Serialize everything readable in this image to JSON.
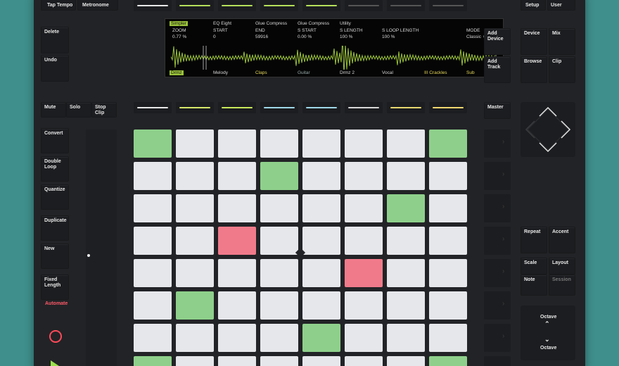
{
  "top_buttons": {
    "tap_tempo": "Tap Tempo",
    "metronome": "Metronome",
    "setup": "Setup",
    "user": "User"
  },
  "left_upper": {
    "delete": "Delete",
    "undo": "Undo"
  },
  "left_mid": {
    "mute": "Mute",
    "solo": "Solo",
    "stop_clip": "Stop Clip"
  },
  "left_column": {
    "convert": "Convert",
    "double_loop": "Double Loop",
    "quantize": "Quantize",
    "duplicate": "Duplicate",
    "new": "New",
    "fixed_length": "Fixed Length",
    "automate": "Automate"
  },
  "right_upper": {
    "add_device": "Add Device",
    "add_track": "Add Track",
    "device": "Device",
    "mix": "Mix",
    "browse": "Browse",
    "clip": "Clip",
    "master": "Master"
  },
  "right_lower": {
    "repeat": "Repeat",
    "accent": "Accent",
    "scale": "Scale",
    "layout": "Layout",
    "note": "Note",
    "session": "Session",
    "octave_up": "Octave",
    "octave_down": "Octave"
  },
  "display": {
    "top_row": [
      "Simpler",
      "EQ Eight",
      "Glue Compress",
      "Glue Compress",
      "Utility",
      "",
      "",
      ""
    ],
    "param_names": [
      "ZOOM",
      "START",
      "END",
      "S START",
      "S LENGTH",
      "S LOOP LENGTH",
      "",
      "MODE"
    ],
    "param_values": [
      "0.77 %",
      "0",
      "59916",
      "0.00 %",
      "100 %",
      "100 %",
      "",
      "Classic"
    ],
    "mode_extra": "One-Sh",
    "bottom_row": [
      "Drmz",
      "Melody",
      "Claps",
      "Guitar",
      "Drmz 2",
      "Vocal",
      "III Crackles",
      "Sub"
    ]
  },
  "top_strip_colors": [
    "#e8e8e8",
    "#b6e05a",
    "#b6e05a",
    "#b6e05a",
    "#b6e05a",
    "#555555",
    "#555555",
    "#555555"
  ],
  "track_strip_colors": [
    "#e8e8e8",
    "#d7e86a",
    "#c8e85a",
    "#9fd6e8",
    "#9fd6e8",
    "#d8d8d8",
    "#e8d870",
    "#f0d870"
  ],
  "pads": [
    [
      "green",
      "white",
      "white",
      "white",
      "white",
      "white",
      "white",
      "green"
    ],
    [
      "white",
      "white",
      "white",
      "green",
      "white",
      "white",
      "white",
      "white"
    ],
    [
      "white",
      "white",
      "white",
      "white",
      "white",
      "white",
      "green",
      "white"
    ],
    [
      "white",
      "white",
      "red",
      "white",
      "white",
      "white",
      "white",
      "white"
    ],
    [
      "white",
      "white",
      "white",
      "white",
      "white",
      "red",
      "white",
      "white"
    ],
    [
      "white",
      "green",
      "white",
      "white",
      "white",
      "white",
      "white",
      "white"
    ],
    [
      "white",
      "white",
      "white",
      "white",
      "green",
      "white",
      "white",
      "white"
    ],
    [
      "green",
      "white",
      "white",
      "white",
      "white",
      "white",
      "white",
      "green"
    ]
  ],
  "icons": {
    "record": "record-icon",
    "play": "play-icon",
    "dpad": "arrow-dpad-icon"
  }
}
